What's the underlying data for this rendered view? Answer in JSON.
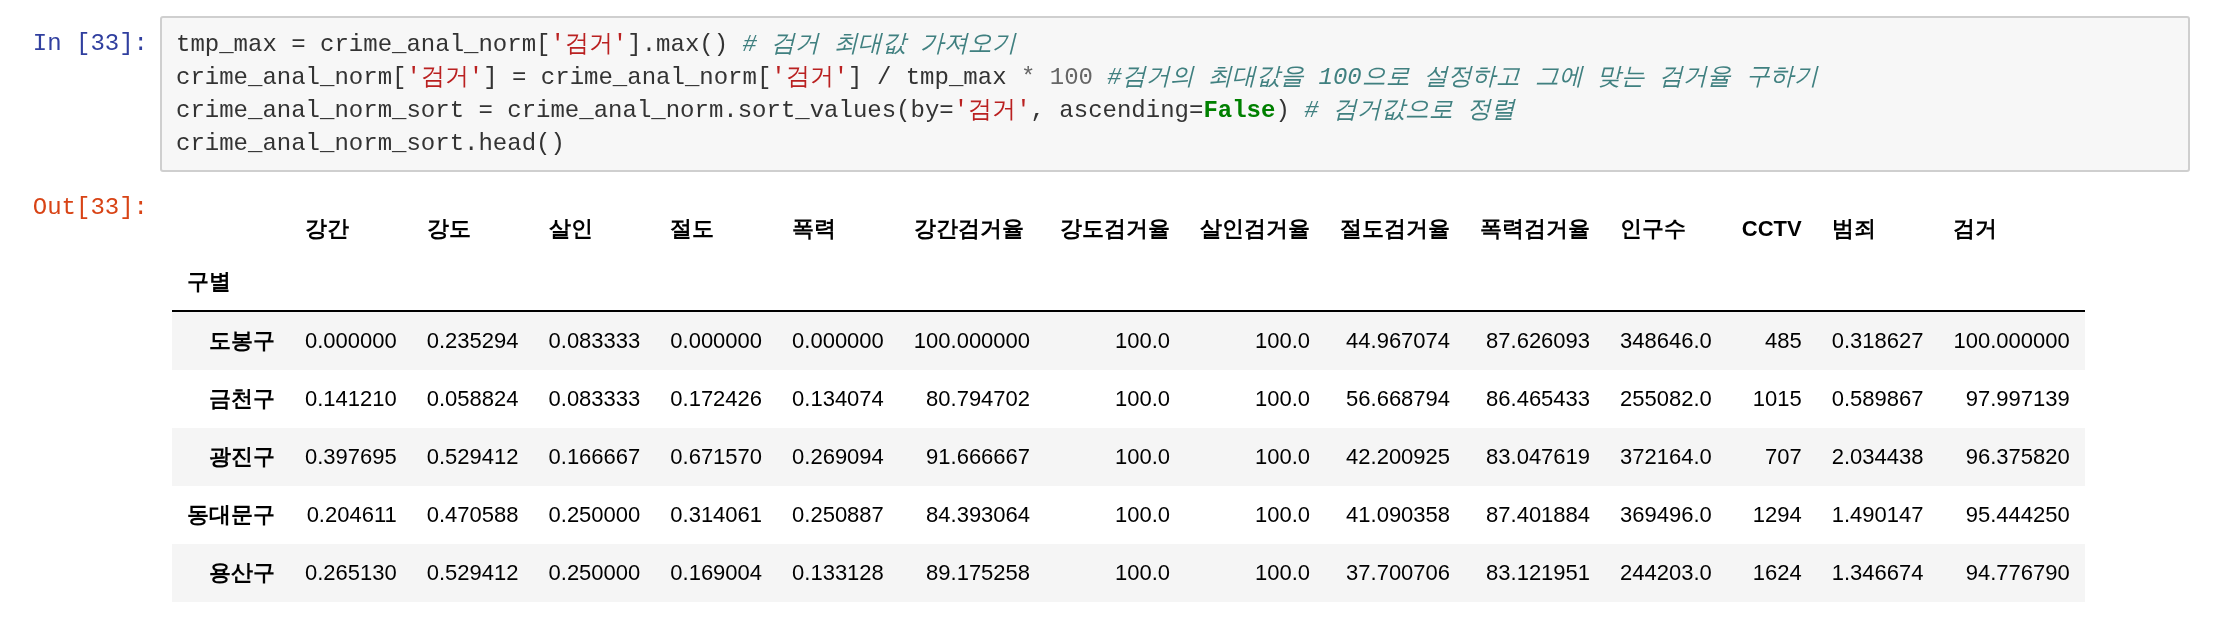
{
  "input_cell": {
    "prompt": "In [33]:",
    "lines": [
      [
        {
          "text": "tmp_max = crime_anal_norm[",
          "kind": "plain"
        },
        {
          "text": "'검거'",
          "kind": "string"
        },
        {
          "text": "].max() ",
          "kind": "plain"
        },
        {
          "text": "# 검거 최대값 가져오기",
          "kind": "comment"
        }
      ],
      [
        {
          "text": "crime_anal_norm[",
          "kind": "plain"
        },
        {
          "text": "'검거'",
          "kind": "string"
        },
        {
          "text": "] = crime_anal_norm[",
          "kind": "plain"
        },
        {
          "text": "'검거'",
          "kind": "string"
        },
        {
          "text": "] / tmp_max ",
          "kind": "plain"
        },
        {
          "text": "* ",
          "kind": "operator"
        },
        {
          "text": "100 ",
          "kind": "number"
        },
        {
          "text": "#검거의 최대값을 100으로 설정하고 그에 맞는 검거율 구하기",
          "kind": "comment"
        }
      ],
      [
        {
          "text": "crime_anal_norm_sort = crime_anal_norm.sort_values(by=",
          "kind": "plain"
        },
        {
          "text": "'검거'",
          "kind": "string"
        },
        {
          "text": ", ascending=",
          "kind": "plain"
        },
        {
          "text": "False",
          "kind": "keyword"
        },
        {
          "text": ") ",
          "kind": "plain"
        },
        {
          "text": "# 검거값으로 정렬",
          "kind": "comment"
        }
      ],
      [
        {
          "text": "crime_anal_norm_sort.head()",
          "kind": "plain"
        }
      ]
    ]
  },
  "output_cell": {
    "prompt": "Out[33]:",
    "table": {
      "columns": [
        "강간",
        "강도",
        "살인",
        "절도",
        "폭력",
        "강간검거율",
        "강도검거율",
        "살인검거율",
        "절도검거율",
        "폭력검거율",
        "인구수",
        "CCTV",
        "범죄",
        "검거"
      ],
      "index_name": "구별",
      "rows": [
        {
          "index": "도봉구",
          "cells": [
            "0.000000",
            "0.235294",
            "0.083333",
            "0.000000",
            "0.000000",
            "100.000000",
            "100.0",
            "100.0",
            "44.967074",
            "87.626093",
            "348646.0",
            "485",
            "0.318627",
            "100.000000"
          ]
        },
        {
          "index": "금천구",
          "cells": [
            "0.141210",
            "0.058824",
            "0.083333",
            "0.172426",
            "0.134074",
            "80.794702",
            "100.0",
            "100.0",
            "56.668794",
            "86.465433",
            "255082.0",
            "1015",
            "0.589867",
            "97.997139"
          ]
        },
        {
          "index": "광진구",
          "cells": [
            "0.397695",
            "0.529412",
            "0.166667",
            "0.671570",
            "0.269094",
            "91.666667",
            "100.0",
            "100.0",
            "42.200925",
            "83.047619",
            "372164.0",
            "707",
            "2.034438",
            "96.375820"
          ]
        },
        {
          "index": "동대문구",
          "cells": [
            "0.204611",
            "0.470588",
            "0.250000",
            "0.314061",
            "0.250887",
            "84.393064",
            "100.0",
            "100.0",
            "41.090358",
            "87.401884",
            "369496.0",
            "1294",
            "1.490147",
            "95.444250"
          ]
        },
        {
          "index": "용산구",
          "cells": [
            "0.265130",
            "0.529412",
            "0.250000",
            "0.169004",
            "0.133128",
            "89.175258",
            "100.0",
            "100.0",
            "37.700706",
            "83.121951",
            "244203.0",
            "1624",
            "1.346674",
            "94.776790"
          ]
        }
      ]
    }
  }
}
